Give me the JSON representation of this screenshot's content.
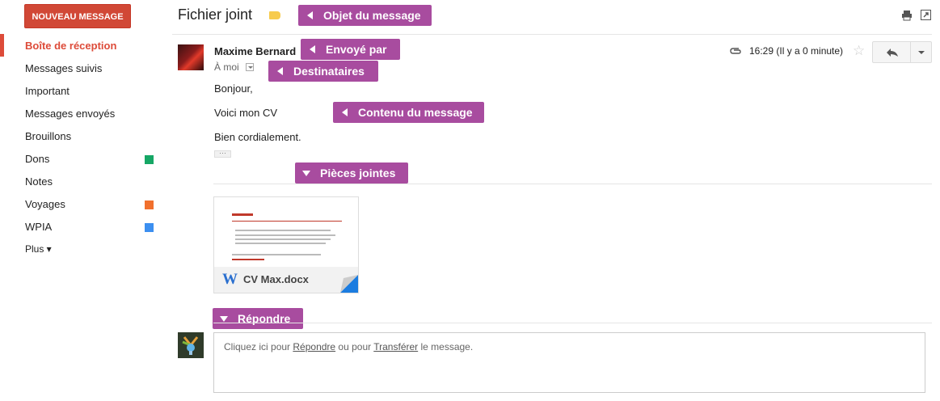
{
  "sidebar": {
    "compose_label": "NOUVEAU MESSAGE",
    "items": [
      {
        "label": "Boîte de réception",
        "active": true
      },
      {
        "label": "Messages suivis"
      },
      {
        "label": "Important"
      },
      {
        "label": "Messages envoyés"
      },
      {
        "label": "Brouillons"
      },
      {
        "label": "Dons",
        "color": "#16a765"
      },
      {
        "label": "Notes"
      },
      {
        "label": "Voyages",
        "color": "#f1702d"
      },
      {
        "label": "WPIA",
        "color": "#3c8ff0"
      },
      {
        "label": "Plus ▾"
      }
    ]
  },
  "header": {
    "subject": "Fichier joint",
    "icons": [
      "label-tag-icon",
      "print-icon",
      "new-window-icon"
    ]
  },
  "annotations": {
    "subject": "Objet du message",
    "sender": "Envoyé par",
    "recipients": "Destinataires",
    "content": "Contenu du message",
    "attachments": "Pièces jointes",
    "reply": "Répondre"
  },
  "message": {
    "sender_name": "Maxime Bernard",
    "recipient": "À moi",
    "time": "16:29 (Il y a 0 minute)",
    "body": [
      "Bonjour,",
      "Voici mon CV",
      "Bien cordialement."
    ],
    "ellipsis": "···"
  },
  "attachment": {
    "filename": "CV Max.docx",
    "file_icon": "W"
  },
  "reply": {
    "prefix": "Cliquez ici pour ",
    "reply_link": "Répondre",
    "middle": " ou pour ",
    "forward_link": "Transférer",
    "suffix": " le message."
  }
}
